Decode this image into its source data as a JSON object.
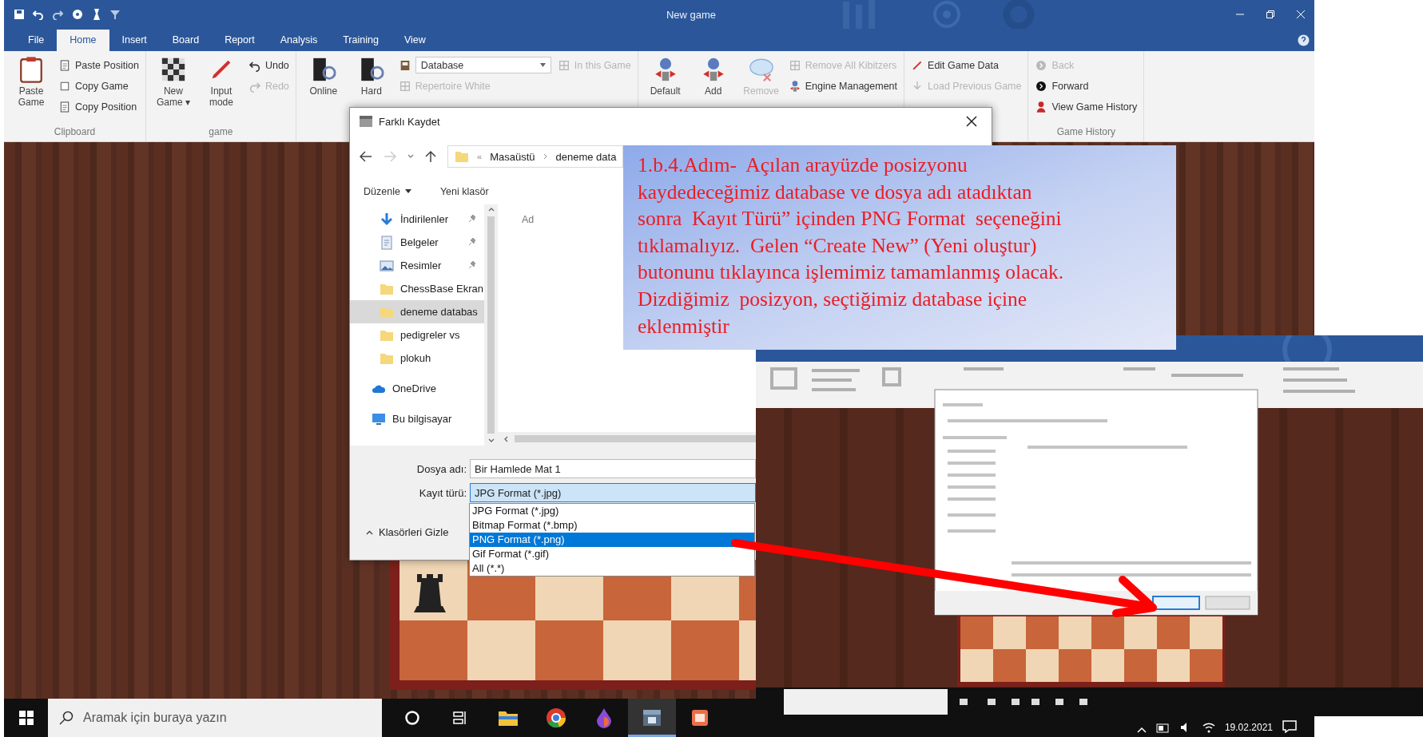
{
  "window": {
    "title": "New game"
  },
  "ribbon_tabs": [
    {
      "label": "File",
      "selected": false
    },
    {
      "label": "Home",
      "selected": true
    },
    {
      "label": "Insert",
      "selected": false
    },
    {
      "label": "Board",
      "selected": false
    },
    {
      "label": "Report",
      "selected": false
    },
    {
      "label": "Analysis",
      "selected": false
    },
    {
      "label": "Training",
      "selected": false
    },
    {
      "label": "View",
      "selected": false
    }
  ],
  "ribbon_groups": [
    {
      "title": "Clipboard",
      "columns": [
        [
          {
            "kind": "large",
            "label": "Paste Game",
            "disabled": false
          }
        ],
        [
          {
            "kind": "small",
            "label": "Paste Position",
            "disabled": false
          },
          {
            "kind": "small",
            "label": "Copy Game",
            "disabled": false
          },
          {
            "kind": "small",
            "label": "Copy Position",
            "disabled": false
          }
        ]
      ]
    },
    {
      "title": "game",
      "columns": [
        [
          {
            "kind": "large",
            "label": "New Game ▾",
            "disabled": false
          }
        ],
        [
          {
            "kind": "large",
            "label": "Input mode",
            "disabled": false
          }
        ],
        [
          {
            "kind": "small",
            "label": "Undo",
            "disabled": false
          },
          {
            "kind": "small",
            "label": "Redo",
            "disabled": true
          }
        ]
      ]
    },
    {
      "columns": [
        [
          {
            "kind": "large",
            "label": "Online",
            "disabled": false
          }
        ],
        [
          {
            "kind": "large",
            "label": "Hard",
            "disabled": false
          }
        ],
        [
          {
            "kind": "combo",
            "label": "Database",
            "disabled": false
          },
          {
            "kind": "small",
            "label": "Repertoire White",
            "disabled": true
          }
        ],
        [
          {
            "kind": "small",
            "label": "In this Game",
            "disabled": true
          }
        ]
      ]
    },
    {
      "columns": [
        [
          {
            "kind": "large",
            "label": "Default",
            "disabled": false
          }
        ],
        [
          {
            "kind": "large",
            "label": "Add",
            "disabled": false
          }
        ],
        [
          {
            "kind": "large",
            "label": "Remove",
            "disabled": true
          }
        ],
        [
          {
            "kind": "small",
            "label": "Remove All Kibitzers",
            "disabled": true
          },
          {
            "kind": "small",
            "label": "Engine Management",
            "disabled": false
          }
        ]
      ]
    },
    {
      "columns": [
        [
          {
            "kind": "small",
            "label": "Edit Game Data",
            "disabled": false
          },
          {
            "kind": "small",
            "label": "Load Previous Game",
            "disabled": true
          }
        ]
      ]
    },
    {
      "title": "Game History",
      "columns": [
        [
          {
            "kind": "small",
            "label": "Back",
            "disabled": true
          },
          {
            "kind": "small",
            "label": "Forward",
            "disabled": false
          },
          {
            "kind": "small",
            "label": "View Game History",
            "disabled": false
          }
        ]
      ]
    }
  ],
  "dialog": {
    "title": "Farklı Kaydet",
    "address_overflow": "«",
    "breadcrumb": [
      "Masaüstü",
      "deneme data"
    ],
    "toolbar": [
      "Düzenle",
      "Yeni klasör"
    ],
    "nav_items": [
      {
        "kind": "download",
        "label": "İndirilenler",
        "pinned": true,
        "selected": false
      },
      {
        "kind": "document",
        "label": "Belgeler",
        "pinned": true,
        "selected": false
      },
      {
        "kind": "pictures",
        "label": "Resimler",
        "pinned": true,
        "selected": false
      },
      {
        "kind": "folder",
        "label": "ChessBase Ekran",
        "pinned": false,
        "selected": false
      },
      {
        "kind": "folder",
        "label": "deneme databas",
        "pinned": false,
        "selected": true
      },
      {
        "kind": "folder",
        "label": "pedigreler vs",
        "pinned": false,
        "selected": false
      },
      {
        "kind": "folder",
        "label": "plokuh",
        "pinned": false,
        "selected": false
      },
      {
        "kind": "cloud",
        "label": "OneDrive",
        "pinned": false,
        "selected": false
      },
      {
        "kind": "computer",
        "label": "Bu bilgisayar",
        "pinned": false,
        "selected": false
      }
    ],
    "column_header": "Ad",
    "fields": [
      {
        "label": "Dosya adı:",
        "value": "Bir Hamlede Mat 1"
      },
      {
        "label": "Kayıt türü:",
        "value": "JPG Format (*.jpg)"
      }
    ],
    "options": [
      {
        "label": "JPG Format (*.jpg)",
        "selected": false
      },
      {
        "label": "Bitmap Format (*.bmp)",
        "selected": false
      },
      {
        "label": "PNG Format (*.png)",
        "selected": true
      },
      {
        "label": "Gif Format (*.gif)",
        "selected": false
      },
      {
        "label": "All (*.*)",
        "selected": false
      }
    ],
    "hide_folders": "Klasörleri Gizle"
  },
  "callout": {
    "text": "1.b.4.Adım-  Açılan arayüzde posizyonu\nkaydedeceğimiz database ve dosya adı atadıktan\nsonra  Kayıt Türü” içinden PNG Format  seçeneğini\ntıklamalıyız.  Gelen “Create New” (Yeni oluştur)\nbutonunu tıklayınca işlemimiz tamamlanmış olacak.\nDizdiğimiz  posizyon, seçtiğimiz database içine\neklenmiştir"
  },
  "taskbar": {
    "search_placeholder": "Aramak için buraya yazın",
    "date": "19.02.2021"
  }
}
